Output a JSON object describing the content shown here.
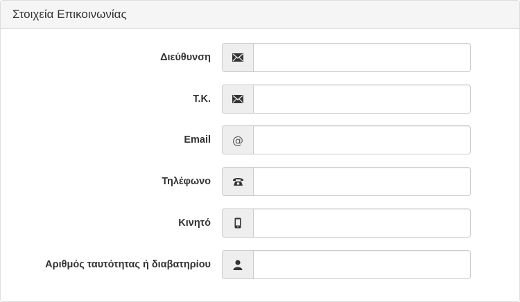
{
  "panel": {
    "title": "Στοιχεία Επικοινωνίας"
  },
  "fields": [
    {
      "label": "Διεύθυνση",
      "icon": "envelope-icon",
      "value": "",
      "placeholder": ""
    },
    {
      "label": "Τ.Κ.",
      "icon": "envelope-icon",
      "value": "",
      "placeholder": ""
    },
    {
      "label": "Email",
      "icon": "at-sign-icon",
      "icon_text": "@",
      "value": "",
      "placeholder": ""
    },
    {
      "label": "Τηλέφωνο",
      "icon": "phone-icon",
      "value": "",
      "placeholder": ""
    },
    {
      "label": "Κινητό",
      "icon": "mobile-phone-icon",
      "value": "",
      "placeholder": ""
    },
    {
      "label": "Αριθμός ταυτότητας ή διαβατηρίου",
      "icon": "user-icon",
      "value": "",
      "placeholder": ""
    }
  ],
  "colors": {
    "heading_bg": "#f5f5f5",
    "border": "#cccccc",
    "addon_bg": "#eeeeee",
    "label_text": "#333333"
  }
}
